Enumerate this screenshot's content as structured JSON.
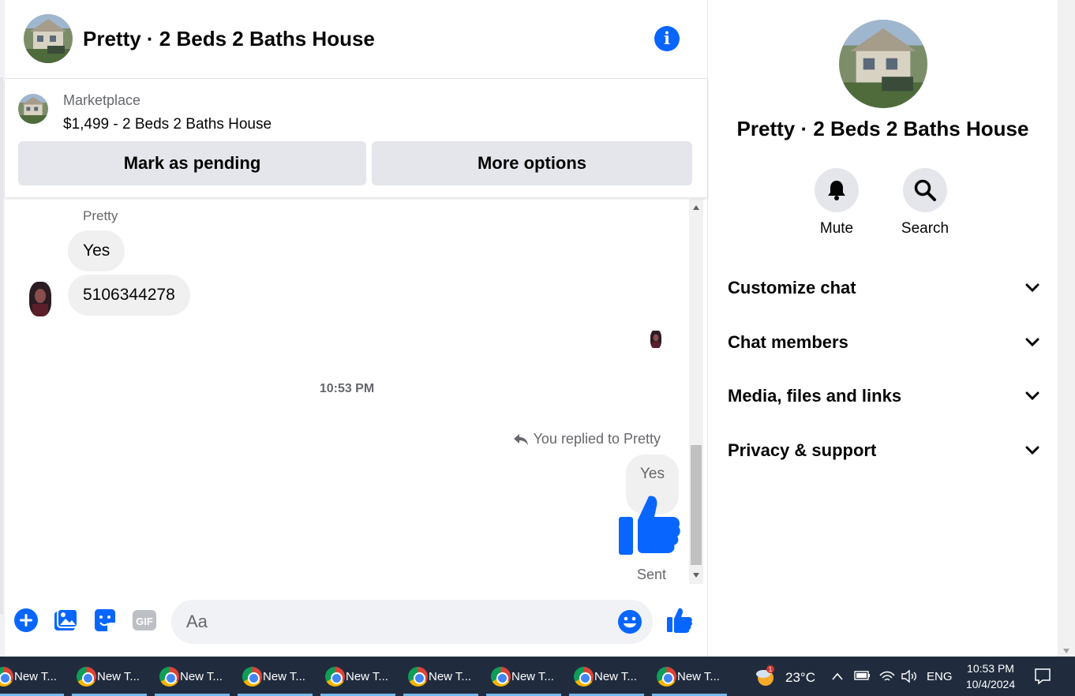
{
  "header": {
    "title": "Pretty · 2 Beds 2 Baths House"
  },
  "marketplace": {
    "label": "Marketplace",
    "listing": "$1,499 - 2 Beds 2 Baths House",
    "mark_pending": "Mark as pending",
    "more_options": "More options"
  },
  "thread": {
    "sender_name": "Pretty",
    "messages": [
      "Yes",
      "5106344278"
    ],
    "timestamp": "10:53 PM",
    "replied_to": "You replied to Pretty",
    "reply_quote": "Yes",
    "status": "Sent"
  },
  "composer": {
    "placeholder": "Aa"
  },
  "side": {
    "title": "Pretty · 2 Beds 2 Baths House",
    "mute_label": "Mute",
    "search_label": "Search",
    "sections": [
      "Customize chat",
      "Chat members",
      "Media, files and links",
      "Privacy & support"
    ]
  },
  "taskbar": {
    "tab_label": "New T...",
    "tab_count": 9,
    "weather_badge": "1",
    "temperature": "23°C",
    "language": "ENG",
    "time": "10:53 PM",
    "date": "10/4/2024"
  },
  "colors": {
    "accent": "#0866ff",
    "bubble": "#f0f0f0",
    "taskbar": "#202c3e"
  }
}
